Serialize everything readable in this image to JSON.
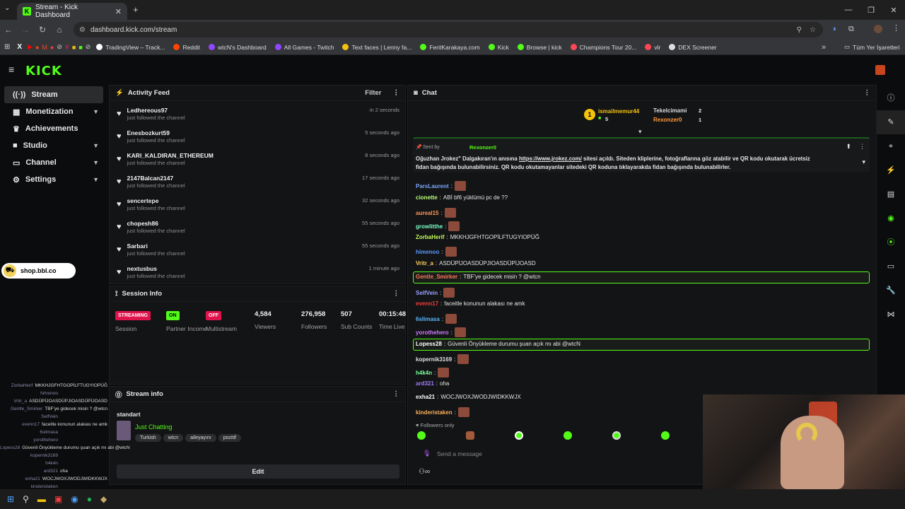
{
  "browser": {
    "tab_title": "Stream - Kick Dashboard",
    "url": "dashboard.kick.com/stream",
    "bookmarks": [
      "TradingView – Track...",
      "Reddit",
      "wtcN's Dashboard",
      "All Games - Twitch",
      "Text faces | Lenny fa...",
      "FeritKarakaya.com",
      "Kick",
      "Browse | kick",
      "Champions Tour 20...",
      "vlr",
      "DEX Screener"
    ],
    "bookmarks_all": "Tüm Yer İşaretleri"
  },
  "app": {
    "logo": "KICK",
    "accent": "#53fc18"
  },
  "sidebar": {
    "items": [
      {
        "label": "Stream",
        "icon": "broadcast-icon"
      },
      {
        "label": "Monetization",
        "icon": "dollar-icon"
      },
      {
        "label": "Achievements",
        "icon": "trophy-icon"
      },
      {
        "label": "Studio",
        "icon": "video-icon"
      },
      {
        "label": "Channel",
        "icon": "tv-icon"
      },
      {
        "label": "Settings",
        "icon": "gear-icon"
      }
    ]
  },
  "shop_banner": "shop.bbl.co",
  "activity": {
    "title": "Activity Feed",
    "filter": "Filter",
    "subtext": "just followed the channel",
    "items": [
      {
        "name": "Ledhereous97",
        "time": "in 2 seconds"
      },
      {
        "name": "Enesbozkurt59",
        "time": "5 seconds ago"
      },
      {
        "name": "KARI_KALDIRAN_ETHEREUM",
        "time": "8 seconds ago"
      },
      {
        "name": "2147Balcan2147",
        "time": "17 seconds ago"
      },
      {
        "name": "sencertepe",
        "time": "32 seconds ago"
      },
      {
        "name": "chopesh86",
        "time": "55 seconds ago"
      },
      {
        "name": "Sarbari",
        "time": "55 seconds ago"
      },
      {
        "name": "nextusbus",
        "time": "1 minute ago"
      }
    ]
  },
  "session": {
    "title": "Session Info",
    "badges": [
      {
        "text": "STREAMING",
        "label": "Session",
        "color": "#e0144c"
      },
      {
        "text": "ON",
        "label": "Partner Income",
        "color": "#53fc18"
      },
      {
        "text": "OFF",
        "label": "Multistream",
        "color": "#e0144c"
      }
    ],
    "stats": [
      {
        "value": "4,584",
        "label": "Viewers"
      },
      {
        "value": "276,958",
        "label": "Followers"
      },
      {
        "value": "507",
        "label": "Sub Counts"
      },
      {
        "value": "00:15:48",
        "label": "Time Live"
      }
    ]
  },
  "stream_info": {
    "title": "Stream info",
    "name": "standart",
    "category": "Just Chatting",
    "tags": [
      "Turkish",
      "wtcn",
      "aileyayını",
      "pozitif"
    ],
    "edit": "Edit"
  },
  "chat": {
    "title": "Chat",
    "top": {
      "first": "ismailmemur44",
      "first_count": "5",
      "second": "Tekelcimami",
      "second_count": "2",
      "third": "Rexonzer0",
      "third_count": "1"
    },
    "pinned": {
      "sent_by": "Sent by",
      "user": "Rexonzer0",
      "text1": "Oğuzhan Jrokez\" Dalgakıran'ın anısına ",
      "link": "https://www.jrokez.com/",
      "text2": " sitesi açıldı. Siteden kliplerine, fotoğraflarına göz atabilir ve QR kodu okutarak ücretsiz",
      "text3": "fidan bağışında bulunabilirsiniz. QR kodu okutamayanlar sitedeki QR koduna tıklayarakda fidan bağışında bulunabilirler."
    },
    "messages": [
      {
        "user": "ParsLaurent",
        "text": "",
        "color": "#7aa6ff",
        "emote": true
      },
      {
        "user": "cionette",
        "text": "ABİ bf6 yüklümü pc de ??",
        "color": "#b8ff7a"
      },
      {
        "user": "aureal15",
        "text": "",
        "color": "#ff9a5a",
        "emote": true
      },
      {
        "user": "growlitthe",
        "text": "",
        "color": "#7affc8",
        "emote": true
      },
      {
        "user": "ZorbaHerif",
        "text": "MKKHJGFHTGOPİLFTUGYIOPÜĞ",
        "color": "#c8ff5a"
      },
      {
        "user": "himenoo",
        "text": "",
        "color": "#5a9aff",
        "emote": true
      },
      {
        "user": "Vritr_a",
        "text": "ASDÜPİJOASDÜPJIOASDÜPİJOASD",
        "color": "#ffd05a"
      },
      {
        "user": "Gentle_Smirker",
        "text": "TBF'ye gidecek misin ? @wtcn",
        "color": "#ff7a5a",
        "highlight": true
      },
      {
        "user": "SelfVein",
        "text": "",
        "color": "#9aa0ff",
        "emote": true
      },
      {
        "user": "evenn17",
        "text": "faceitle konunun alakası ne amk",
        "color": "#ff3a3a"
      },
      {
        "user": "6slimasa",
        "text": "",
        "color": "#5ab8ff",
        "emote": true
      },
      {
        "user": "yorothehero",
        "text": "",
        "color": "#d07aff",
        "emote": true
      },
      {
        "user": "Lopess28",
        "text": "Güvenli Önyükleme durumu şuan açık mı abi @wtcN",
        "color": "#ffffff",
        "highlight": true
      },
      {
        "user": "kopernik3169",
        "text": "",
        "color": "#e0e0e0",
        "emote": true
      },
      {
        "user": "h4k4n",
        "text": "",
        "color": "#7aff9a",
        "emote": true
      },
      {
        "user": "ard321",
        "text": "oha",
        "color": "#a07aff"
      },
      {
        "user": "exha21",
        "text": "WOCJWOXJWODJWIDKKWJX",
        "color": "#ffffff"
      },
      {
        "user": "kinderistaken",
        "text": "",
        "color": "#ffb05a",
        "emote": true
      }
    ],
    "followers_only": "Followers only",
    "placeholder": "Send a message"
  }
}
